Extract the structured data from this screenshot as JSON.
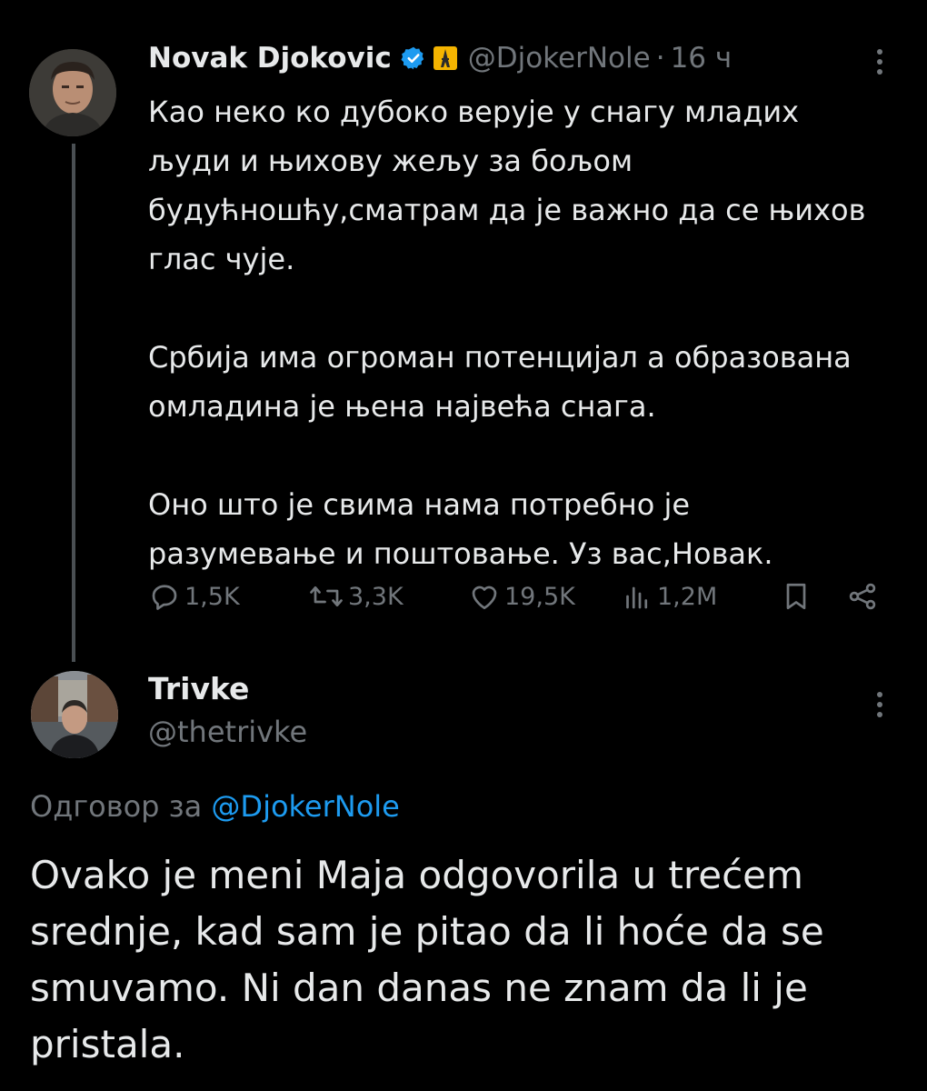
{
  "tweet": {
    "author_name": "Novak Djokovic",
    "handle": "@DjokerNole",
    "separator": "·",
    "time": "16 ч",
    "paragraphs": [
      "Као неко ко дубоко верује у снагу младих\nљуди и њихову жељу за бољом\nбудућношћу,сматрам да је важно да се њихов\nглас чује.",
      "Србија има огроман потенцијал а образована\nомладина је њена највећа снага.",
      "Оно што је свима нама потребно је\nразумевање и поштовање. Уз вас,Новак."
    ],
    "actions": {
      "replies": "1,5K",
      "reposts": "3,3K",
      "likes": "19,5K",
      "views": "1,2M"
    }
  },
  "reply": {
    "author_name": "Trivke",
    "handle": "@thetrivke",
    "reply_to_label": "Одговор за ",
    "reply_to_mention": "@DjokerNole",
    "text": "Ovako je meni Maja odgovorila u trećem\nsrednje, kad sam je pitao da li hoće da se\nsmuvamo. Ni dan danas ne znam da li je\npristala."
  },
  "colors": {
    "background": "#000000",
    "text": "#e7e9ea",
    "muted": "#71767b",
    "link": "#1d9bf0",
    "verified": "#1d9bf0"
  },
  "icons": [
    "verified-badge-icon",
    "eiffel-tower-emoji-icon",
    "more-icon",
    "reply-icon",
    "repost-icon",
    "like-icon",
    "views-icon",
    "bookmark-icon",
    "share-icon"
  ]
}
